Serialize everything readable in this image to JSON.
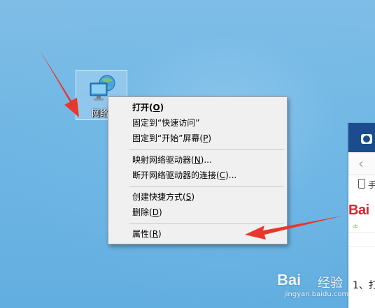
{
  "desktop": {
    "icon": {
      "label": "网络",
      "icon_name": "network-computer-icon"
    }
  },
  "context_menu": {
    "groups": [
      [
        {
          "text": "打开(",
          "mnemonic": "O",
          "suffix": ")",
          "bold": true
        },
        {
          "text": "固定到“快速访问”",
          "mnemonic": "",
          "suffix": ""
        },
        {
          "text": "固定到“开始”屏幕(",
          "mnemonic": "P",
          "suffix": ")"
        }
      ],
      [
        {
          "text": "映射网络驱动器(",
          "mnemonic": "N",
          "suffix": ")..."
        },
        {
          "text": "断开网络驱动器的连接(",
          "mnemonic": "C",
          "suffix": ")..."
        }
      ],
      [
        {
          "text": "创建快捷方式(",
          "mnemonic": "S",
          "suffix": ")"
        },
        {
          "text": "删除(",
          "mnemonic": "D",
          "suffix": ")"
        }
      ],
      [
        {
          "text": "属性(",
          "mnemonic": "R",
          "suffix": ")"
        }
      ]
    ]
  },
  "browser_partial": {
    "address_text": "手",
    "logo_text": "Bai",
    "logo_tag": "cb",
    "content_text": "1、打"
  },
  "watermark": {
    "logo": "Bai",
    "text": "经验",
    "url": "jingyan.baidu.com"
  },
  "annotations": {
    "arrow_color": "#e8372c"
  }
}
